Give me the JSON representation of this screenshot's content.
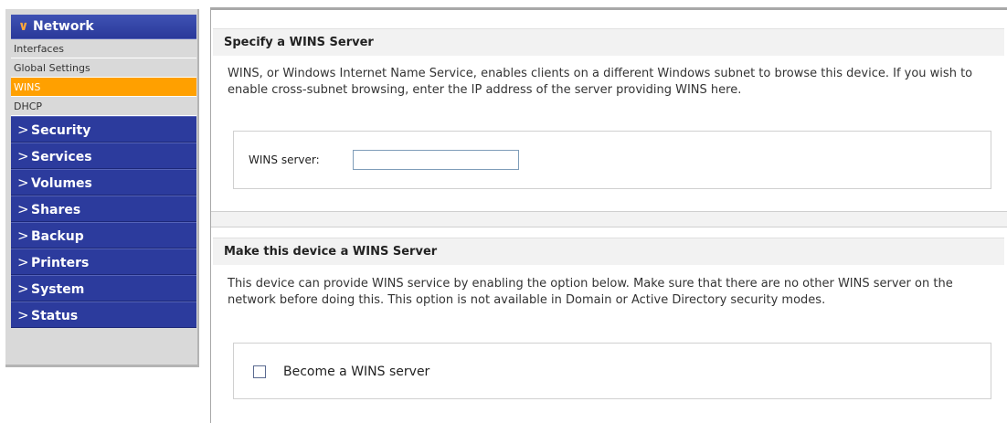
{
  "sidebar": {
    "active_group": {
      "label": "Network",
      "icon": "chevron-down-icon"
    },
    "sub_items": [
      {
        "label": "Interfaces",
        "active": false
      },
      {
        "label": "Global Settings",
        "active": false
      },
      {
        "label": "WINS",
        "active": true
      },
      {
        "label": "DHCP",
        "active": false
      }
    ],
    "groups": [
      {
        "label": "Security",
        "icon": "chevron-right-icon"
      },
      {
        "label": "Services",
        "icon": "chevron-right-icon"
      },
      {
        "label": "Volumes",
        "icon": "chevron-right-icon"
      },
      {
        "label": "Shares",
        "icon": "chevron-right-icon"
      },
      {
        "label": "Backup",
        "icon": "chevron-right-icon"
      },
      {
        "label": "Printers",
        "icon": "chevron-right-icon"
      },
      {
        "label": "System",
        "icon": "chevron-right-icon"
      },
      {
        "label": "Status",
        "icon": "chevron-right-icon"
      }
    ],
    "colors": {
      "nav_blue": "#2c3b9d",
      "active_orange": "#ffa000"
    }
  },
  "wins_client": {
    "title": "Specify a WINS Server",
    "description": "WINS, or Windows Internet Name Service, enables clients on a different Windows subnet to browse this device. If you wish to enable cross-subnet browsing, enter the IP address of the server providing WINS here.",
    "field_label": "WINS server:",
    "field_value": ""
  },
  "wins_server": {
    "title": "Make this device a WINS Server",
    "description": "This device can provide WINS service by enabling the option below. Make sure that there are no other WINS server on the network before doing this. This option is not available in Domain or Active Directory security modes.",
    "checkbox_label": "Become a WINS server",
    "checked": false
  }
}
